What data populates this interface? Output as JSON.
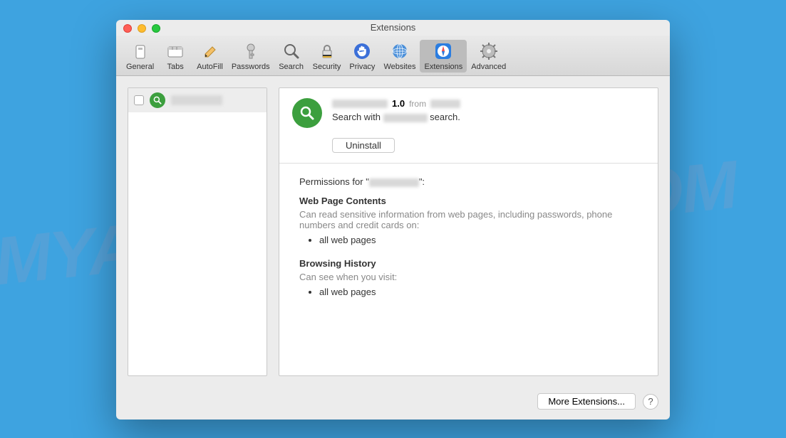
{
  "window": {
    "title": "Extensions"
  },
  "toolbar": {
    "items": [
      {
        "label": "General"
      },
      {
        "label": "Tabs"
      },
      {
        "label": "AutoFill"
      },
      {
        "label": "Passwords"
      },
      {
        "label": "Search"
      },
      {
        "label": "Security"
      },
      {
        "label": "Privacy"
      },
      {
        "label": "Websites"
      },
      {
        "label": "Extensions"
      },
      {
        "label": "Advanced"
      }
    ]
  },
  "detail": {
    "version": "1.0",
    "from": "from",
    "desc_prefix": "Search with",
    "desc_suffix": "search.",
    "uninstall_label": "Uninstall",
    "permissions_label_prefix": "Permissions for \"",
    "permissions_label_suffix": "\":",
    "sections": [
      {
        "title": "Web Page Contents",
        "text": "Can read sensitive information from web pages, including passwords, phone numbers and credit cards on:",
        "items": [
          "all web pages"
        ]
      },
      {
        "title": "Browsing History",
        "text": "Can see when you visit:",
        "items": [
          "all web pages"
        ]
      }
    ]
  },
  "footer": {
    "more_label": "More Extensions...",
    "help_label": "?"
  }
}
